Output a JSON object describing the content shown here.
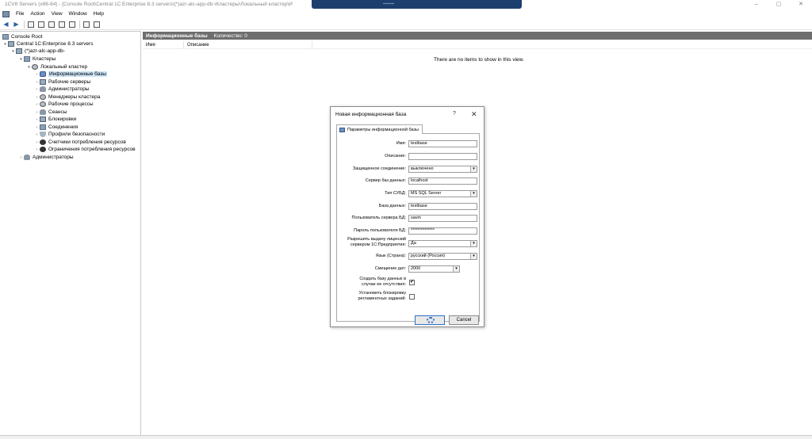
{
  "window": {
    "title": "1CV8 Servers (x86-64) - [Console Root\\Central 1C:Enterprise 8.3 servers\\(*)azr-alc-app-db-\\Кластеры\\Локальный кластер\\И"
  },
  "menu": [
    "File",
    "Action",
    "View",
    "Window",
    "Help"
  ],
  "tree": {
    "items": [
      {
        "label": "Console Root",
        "icon": "folder-icon",
        "level": 0
      },
      {
        "label": "Central 1C:Enterprise 8.3 servers",
        "icon": "server-icon",
        "level": 1
      },
      {
        "label": "(*)azr-alc-app-db-",
        "icon": "server-icon",
        "level": 2
      },
      {
        "label": "Кластеры",
        "icon": "folder-icon",
        "level": 3
      },
      {
        "label": "Локальный кластер",
        "icon": "gear-icon",
        "level": 4
      },
      {
        "label": "Информационные базы",
        "icon": "database-icon",
        "level": 5,
        "selected": true
      },
      {
        "label": "Рабочие серверы",
        "icon": "server-icon",
        "level": 5
      },
      {
        "label": "Администраторы",
        "icon": "user-icon",
        "level": 5
      },
      {
        "label": "Менеджеры кластера",
        "icon": "gear-icon",
        "level": 5
      },
      {
        "label": "Рабочие процессы",
        "icon": "gear-icon",
        "level": 5
      },
      {
        "label": "Сеансы",
        "icon": "user-icon",
        "level": 5
      },
      {
        "label": "Блокировки",
        "icon": "lock-icon",
        "level": 5
      },
      {
        "label": "Соединения",
        "icon": "connection-icon",
        "level": 5
      },
      {
        "label": "Профили безопасности",
        "icon": "shield-icon",
        "level": 5
      },
      {
        "label": "Счетчики потребления ресурсов",
        "icon": "counter-icon",
        "level": 5
      },
      {
        "label": "Ограничения потребления ресурсов",
        "icon": "limit-icon",
        "level": 5
      },
      {
        "label": "Администраторы",
        "icon": "user-icon",
        "level": 3
      }
    ]
  },
  "content": {
    "header_title": "Информационные базы",
    "header_count": "Количество: 0",
    "columns": [
      "Имя",
      "Описание"
    ],
    "empty_message": "There are no items to show in this view."
  },
  "dialog": {
    "title": "Новая информационная база",
    "help": "?",
    "close": "✕",
    "tab_label": "Параметры информационной базы",
    "fields": {
      "name_label": "Имя:",
      "name_value": "testbase",
      "description_label": "Описание:",
      "description_value": "",
      "secure_label": "Защищенное соединение:",
      "secure_value": "выключено",
      "db_server_label": "Сервер баз данных:",
      "db_server_value": "localhost",
      "dbms_label": "Тип СУБД:",
      "dbms_value": "MS SQL Server",
      "database_label": "База данных:",
      "database_value": "testbase",
      "db_user_label": "Пользователь сервера БД:",
      "db_user_value": "savin",
      "db_password_label": "Пароль пользователя БД:",
      "db_password_value": "**************",
      "license_label": "Разрешить выдачу лицензий сервером 1С:Предприятия:",
      "license_value": "Да",
      "locale_label": "Язык (Страна):",
      "locale_value": "русский (Россия)",
      "date_offset_label": "Смещение дат:",
      "date_offset_value": "2000",
      "create_db_label": "Создать базу данных в случае ее отсутствия:",
      "create_db_checked": "✔",
      "block_jobs_label": "Установить блокировку регламентных заданий:",
      "block_jobs_checked": ""
    },
    "ok_label": "",
    "cancel_label": "Cancel"
  }
}
